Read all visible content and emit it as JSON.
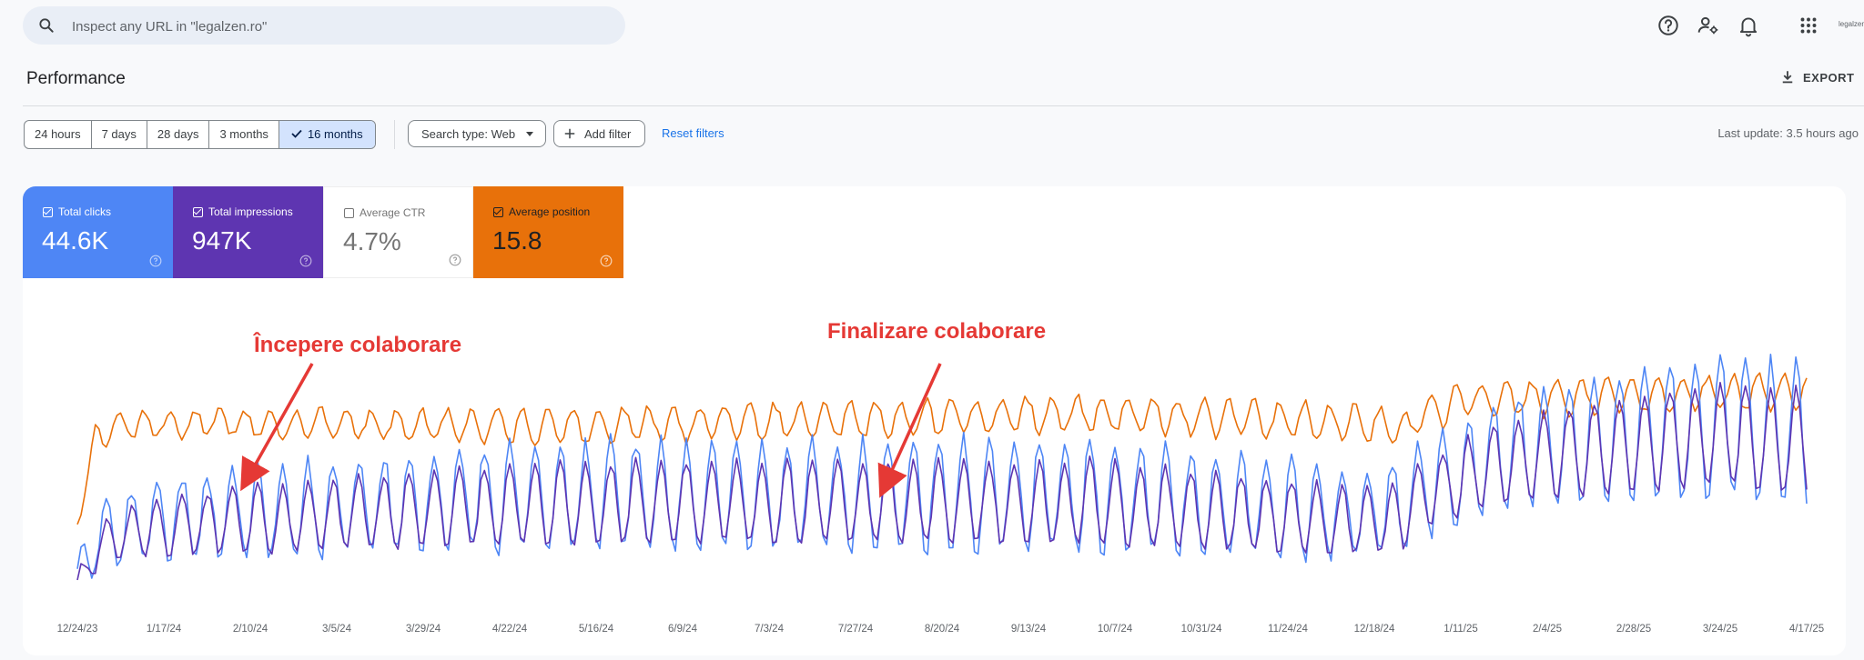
{
  "search": {
    "placeholder": "Inspect any URL in \"legalzen.ro\""
  },
  "top_icons": [
    "help-icon",
    "manage-users-icon",
    "notifications-icon",
    "apps-grid-icon"
  ],
  "brand_text": "legalzen",
  "page": {
    "title": "Performance",
    "export_label": "EXPORT"
  },
  "date_ranges": [
    {
      "label": "24 hours",
      "active": false
    },
    {
      "label": "7 days",
      "active": false
    },
    {
      "label": "28 days",
      "active": false
    },
    {
      "label": "3 months",
      "active": false
    },
    {
      "label": "16 months",
      "active": true
    }
  ],
  "filters": {
    "search_type": "Search type: Web",
    "add_filter": "Add filter",
    "reset": "Reset filters",
    "last_update": "Last update: 3.5 hours ago"
  },
  "metrics": [
    {
      "label": "Total clicks",
      "value": "44.6K",
      "checked": true,
      "color": "#4e86f5"
    },
    {
      "label": "Total impressions",
      "value": "947K",
      "checked": true,
      "color": "#5e35b1"
    },
    {
      "label": "Average CTR",
      "value": "4.7%",
      "checked": false,
      "color": "#ffffff"
    },
    {
      "label": "Average position",
      "value": "15.8",
      "checked": true,
      "color": "#e8710a"
    }
  ],
  "annotations": {
    "start": "Începere colaborare",
    "end": "Finalizare colaborare",
    "color": "#e53935"
  },
  "chart_data": {
    "type": "line",
    "x_labels": [
      "12/24/23",
      "1/17/24",
      "2/10/24",
      "3/5/24",
      "3/29/24",
      "4/22/24",
      "5/16/24",
      "6/9/24",
      "7/3/24",
      "7/27/24",
      "8/20/24",
      "9/13/24",
      "10/7/24",
      "10/31/24",
      "11/24/24",
      "12/18/24",
      "1/11/25",
      "2/4/25",
      "2/28/25",
      "3/24/25",
      "4/17/25"
    ],
    "x_range": [
      "2023-12-24",
      "2025-04-22"
    ],
    "grid": false,
    "legend": "metric tiles above chart",
    "series": [
      {
        "name": "Total clicks",
        "color": "#4e86f5",
        "normalized": true
      },
      {
        "name": "Total impressions",
        "color": "#5e35b1",
        "normalized": true
      },
      {
        "name": "Average position",
        "color": "#e8710a",
        "normalized": true
      }
    ]
  }
}
